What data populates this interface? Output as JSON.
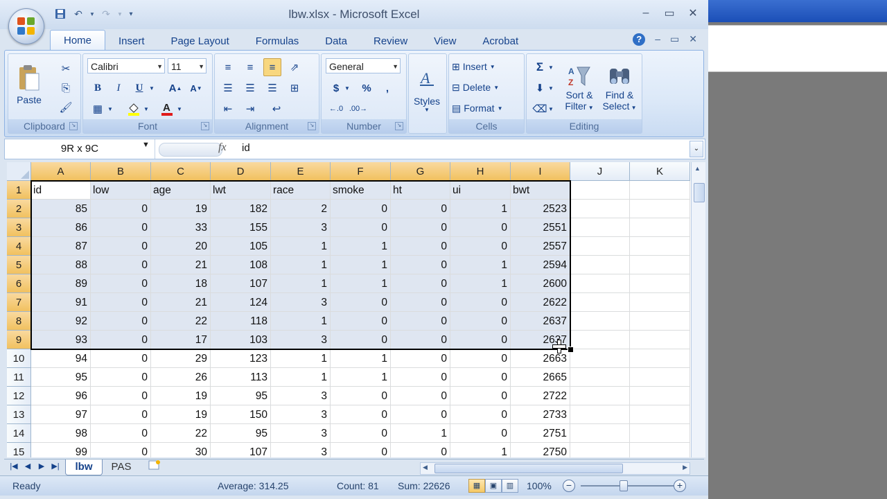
{
  "window": {
    "title": "lbw.xlsx - Microsoft Excel",
    "controls": [
      "–",
      "▭",
      "✕"
    ]
  },
  "ribbon": {
    "tabs": [
      "Home",
      "Insert",
      "Page Layout",
      "Formulas",
      "Data",
      "Review",
      "View",
      "Acrobat"
    ],
    "active_tab": "Home",
    "groups": {
      "clipboard": {
        "label": "Clipboard",
        "paste": "Paste"
      },
      "font": {
        "label": "Font",
        "font_name": "Calibri",
        "font_size": "11"
      },
      "alignment": {
        "label": "Alignment"
      },
      "number": {
        "label": "Number",
        "format": "General"
      },
      "styles": {
        "label": "Styles"
      },
      "cells": {
        "label": "Cells",
        "insert": "Insert",
        "delete": "Delete",
        "format": "Format"
      },
      "editing": {
        "label": "Editing",
        "sort_filter_1": "Sort &",
        "sort_filter_2": "Filter",
        "find_select_1": "Find &",
        "find_select_2": "Select"
      }
    }
  },
  "formula_bar": {
    "name_box": "9R x 9C",
    "fx": "fx",
    "value": "id"
  },
  "sheet": {
    "columns": [
      "A",
      "B",
      "C",
      "D",
      "E",
      "F",
      "G",
      "H",
      "I",
      "J",
      "K"
    ],
    "row_numbers": [
      "1",
      "2",
      "3",
      "4",
      "5",
      "6",
      "7",
      "8",
      "9",
      "10",
      "11",
      "12",
      "13",
      "14",
      "15"
    ],
    "rows": [
      [
        "id",
        "low",
        "age",
        "lwt",
        "race",
        "smoke",
        "ht",
        "ui",
        "bwt",
        "",
        ""
      ],
      [
        "85",
        "0",
        "19",
        "182",
        "2",
        "0",
        "0",
        "1",
        "2523",
        "",
        ""
      ],
      [
        "86",
        "0",
        "33",
        "155",
        "3",
        "0",
        "0",
        "0",
        "2551",
        "",
        ""
      ],
      [
        "87",
        "0",
        "20",
        "105",
        "1",
        "1",
        "0",
        "0",
        "2557",
        "",
        ""
      ],
      [
        "88",
        "0",
        "21",
        "108",
        "1",
        "1",
        "0",
        "1",
        "2594",
        "",
        ""
      ],
      [
        "89",
        "0",
        "18",
        "107",
        "1",
        "1",
        "0",
        "1",
        "2600",
        "",
        ""
      ],
      [
        "91",
        "0",
        "21",
        "124",
        "3",
        "0",
        "0",
        "0",
        "2622",
        "",
        ""
      ],
      [
        "92",
        "0",
        "22",
        "118",
        "1",
        "0",
        "0",
        "0",
        "2637",
        "",
        ""
      ],
      [
        "93",
        "0",
        "17",
        "103",
        "3",
        "0",
        "0",
        "0",
        "2637",
        "",
        ""
      ],
      [
        "94",
        "0",
        "29",
        "123",
        "1",
        "1",
        "0",
        "0",
        "2663",
        "",
        ""
      ],
      [
        "95",
        "0",
        "26",
        "113",
        "1",
        "1",
        "0",
        "0",
        "2665",
        "",
        ""
      ],
      [
        "96",
        "0",
        "19",
        "95",
        "3",
        "0",
        "0",
        "0",
        "2722",
        "",
        ""
      ],
      [
        "97",
        "0",
        "19",
        "150",
        "3",
        "0",
        "0",
        "0",
        "2733",
        "",
        ""
      ],
      [
        "98",
        "0",
        "22",
        "95",
        "3",
        "0",
        "1",
        "0",
        "2751",
        "",
        ""
      ],
      [
        "99",
        "0",
        "30",
        "107",
        "3",
        "0",
        "0",
        "1",
        "2750",
        "",
        ""
      ]
    ]
  },
  "sheet_tabs": [
    "lbw",
    "PAS"
  ],
  "active_sheet": "lbw",
  "status": {
    "ready": "Ready",
    "average": "Average: 314.25",
    "count": "Count: 81",
    "sum": "Sum: 22626",
    "zoom": "100%"
  },
  "colors": {
    "selection_header": "#f1c15f",
    "selection_fill": "#dfe6f1",
    "ribbon_text": "#15428b"
  }
}
